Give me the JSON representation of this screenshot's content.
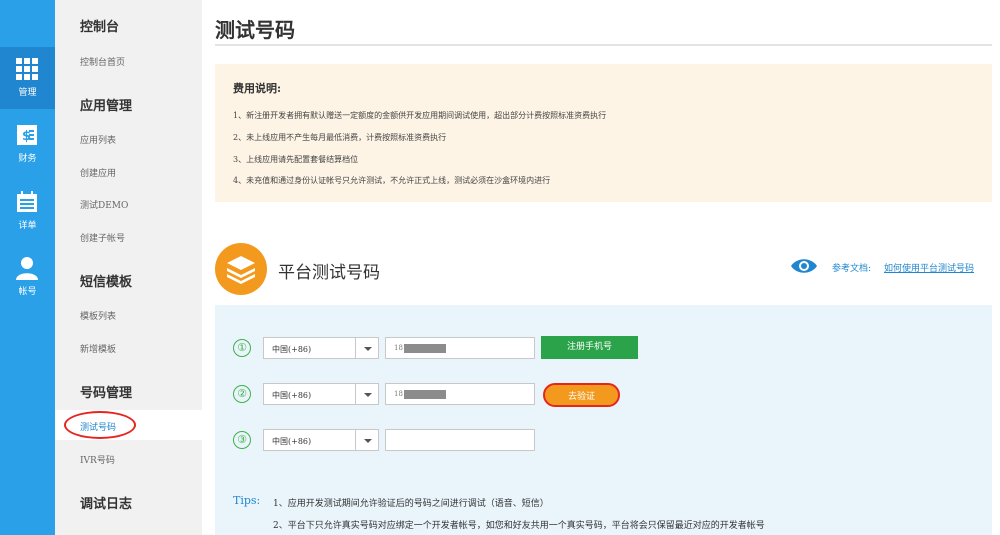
{
  "rail": {
    "items": [
      {
        "label": "管理",
        "icon": "grid-icon",
        "active": true
      },
      {
        "label": "财务",
        "icon": "finance-icon",
        "active": false
      },
      {
        "label": "详单",
        "icon": "calendar-icon",
        "active": false
      },
      {
        "label": "帐号",
        "icon": "user-icon",
        "active": false
      }
    ]
  },
  "nav": {
    "groups": [
      {
        "title": "控制台",
        "items": [
          "控制台首页"
        ]
      },
      {
        "title": "应用管理",
        "items": [
          "应用列表",
          "创建应用",
          "测试DEMO",
          "创建子帐号"
        ]
      },
      {
        "title": "短信模板",
        "items": [
          "模板列表",
          "新增模板"
        ]
      },
      {
        "title": "号码管理",
        "items": [
          "测试号码",
          "IVR号码"
        ]
      },
      {
        "title": "调试日志",
        "items": []
      }
    ],
    "active_item": "测试号码"
  },
  "page": {
    "title": "测试号码"
  },
  "notice": {
    "title": "费用说明:",
    "lines": [
      "1、新注册开发者拥有默认赠送一定额度的金额供开发应用期间调试使用，超出部分计费按照标准资费执行",
      "2、未上线应用不产生每月最低消费，计费按照标准资费执行",
      "3、上线应用请先配置套餐结算档位",
      "4、未充值和通过身份认证帐号只允许测试，不允许正式上线，测试必须在沙盒环境内进行"
    ]
  },
  "section": {
    "title": "平台测试号码",
    "ref_label": "参考文档:",
    "ref_link": "如何使用平台测试号码"
  },
  "rows": [
    {
      "num": "①",
      "country": "中国(+86)",
      "phone_prefix": "18",
      "button": "注册手机号"
    },
    {
      "num": "②",
      "country": "中国(+86)",
      "phone_prefix": "18",
      "button": "去验证"
    },
    {
      "num": "③",
      "country": "中国(+86)",
      "phone_prefix": "",
      "button": ""
    }
  ],
  "tips": {
    "label": "Tips:",
    "lines": [
      "1、应用开发测试期间允许验证后的号码之间进行调试（语音、短信）",
      "2、平台下只允许真实号码对应绑定一个开发者帐号，如您和好友共用一个真实号码，平台将会只保留最近对应的开发者帐号"
    ]
  },
  "colors": {
    "rail": "#2aa0e8",
    "accent": "#1f86cf",
    "green": "#2aa34a",
    "orange": "#f39a1e",
    "highlight_circle": "#e5261f"
  }
}
